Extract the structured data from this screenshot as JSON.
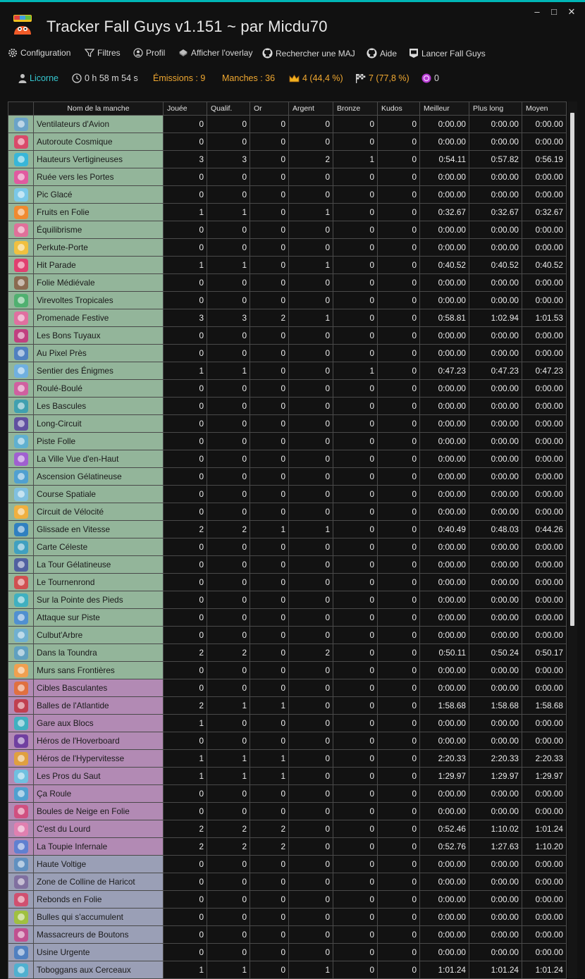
{
  "app": {
    "title": "Tracker Fall Guys v1.151 ~ par Micdu70",
    "minimize": "–",
    "maximize": "□",
    "close": "✕"
  },
  "menu": {
    "configuration": "Configuration",
    "filters": "Filtres",
    "profile": "Profil",
    "overlay": "Afficher l'overlay",
    "update": "Rechercher une MAJ",
    "help": "Aide",
    "launch": "Lancer Fall Guys"
  },
  "status": {
    "profile": "Licorne",
    "time": "0 h 58 m 54 s",
    "shows": "Émissions : 9",
    "rounds": "Manches : 36",
    "wins": "4 (44,4 %)",
    "finals": "7 (77,8 %)",
    "kudos": "0"
  },
  "colors": {
    "race": "#93b59a",
    "hunt": "#b28ab4",
    "final": "#9a9fb6",
    "accent_teal": "#00b6b6",
    "orange": "#f0a830"
  },
  "table": {
    "headers": [
      "Nom de la manche",
      "Jouée",
      "Qualif.",
      "Or",
      "Argent",
      "Bronze",
      "Kudos",
      "Meilleur",
      "Plus long",
      "Moyen"
    ],
    "rows": [
      {
        "cat": "race",
        "color": "#6aa3c8",
        "name": "Ventilateurs d'Avion",
        "v": [
          "0",
          "0",
          "0",
          "0",
          "0",
          "0",
          "0:00.00",
          "0:00.00",
          "0:00.00"
        ]
      },
      {
        "cat": "race",
        "color": "#d94a6a",
        "name": "Autoroute Cosmique",
        "v": [
          "0",
          "0",
          "0",
          "0",
          "0",
          "0",
          "0:00.00",
          "0:00.00",
          "0:00.00"
        ]
      },
      {
        "cat": "race",
        "color": "#38b6d8",
        "name": "Hauteurs Vertigineuses",
        "v": [
          "3",
          "3",
          "0",
          "2",
          "1",
          "0",
          "0:54.11",
          "0:57.82",
          "0:56.19"
        ]
      },
      {
        "cat": "race",
        "color": "#e05aa0",
        "name": "Ruée vers les Portes",
        "v": [
          "0",
          "0",
          "0",
          "0",
          "0",
          "0",
          "0:00.00",
          "0:00.00",
          "0:00.00"
        ]
      },
      {
        "cat": "race",
        "color": "#7ac8e8",
        "name": "Pic Glacé",
        "v": [
          "0",
          "0",
          "0",
          "0",
          "0",
          "0",
          "0:00.00",
          "0:00.00",
          "0:00.00"
        ]
      },
      {
        "cat": "race",
        "color": "#f08a30",
        "name": "Fruits en Folie",
        "v": [
          "1",
          "1",
          "0",
          "1",
          "0",
          "0",
          "0:32.67",
          "0:32.67",
          "0:32.67"
        ]
      },
      {
        "cat": "race",
        "color": "#e0709a",
        "name": "Équilibrisme",
        "v": [
          "0",
          "0",
          "0",
          "0",
          "0",
          "0",
          "0:00.00",
          "0:00.00",
          "0:00.00"
        ]
      },
      {
        "cat": "race",
        "color": "#f0c040",
        "name": "Perkute-Porte",
        "v": [
          "0",
          "0",
          "0",
          "0",
          "0",
          "0",
          "0:00.00",
          "0:00.00",
          "0:00.00"
        ]
      },
      {
        "cat": "race",
        "color": "#e04070",
        "name": "Hit Parade",
        "v": [
          "1",
          "1",
          "0",
          "1",
          "0",
          "0",
          "0:40.52",
          "0:40.52",
          "0:40.52"
        ]
      },
      {
        "cat": "race",
        "color": "#8a6a50",
        "name": "Folie Médiévale",
        "v": [
          "0",
          "0",
          "0",
          "0",
          "0",
          "0",
          "0:00.00",
          "0:00.00",
          "0:00.00"
        ]
      },
      {
        "cat": "race",
        "color": "#50b070",
        "name": "Virevoltes Tropicales",
        "v": [
          "0",
          "0",
          "0",
          "0",
          "0",
          "0",
          "0:00.00",
          "0:00.00",
          "0:00.00"
        ]
      },
      {
        "cat": "race",
        "color": "#e070a0",
        "name": "Promenade Festive",
        "v": [
          "3",
          "3",
          "2",
          "1",
          "0",
          "0",
          "0:58.81",
          "1:02.94",
          "1:01.53"
        ]
      },
      {
        "cat": "race",
        "color": "#c04080",
        "name": "Les Bons Tuyaux",
        "v": [
          "0",
          "0",
          "0",
          "0",
          "0",
          "0",
          "0:00.00",
          "0:00.00",
          "0:00.00"
        ]
      },
      {
        "cat": "race",
        "color": "#5080c0",
        "name": "Au Pixel Près",
        "v": [
          "0",
          "0",
          "0",
          "0",
          "0",
          "0",
          "0:00.00",
          "0:00.00",
          "0:00.00"
        ]
      },
      {
        "cat": "race",
        "color": "#70b0e0",
        "name": "Sentier des Énigmes",
        "v": [
          "1",
          "1",
          "0",
          "0",
          "1",
          "0",
          "0:47.23",
          "0:47.23",
          "0:47.23"
        ]
      },
      {
        "cat": "race",
        "color": "#d060a0",
        "name": "Roulé-Boulé",
        "v": [
          "0",
          "0",
          "0",
          "0",
          "0",
          "0",
          "0:00.00",
          "0:00.00",
          "0:00.00"
        ]
      },
      {
        "cat": "race",
        "color": "#40a0b0",
        "name": "Les Bascules",
        "v": [
          "0",
          "0",
          "0",
          "0",
          "0",
          "0",
          "0:00.00",
          "0:00.00",
          "0:00.00"
        ]
      },
      {
        "cat": "race",
        "color": "#6050a0",
        "name": "Long-Circuit",
        "v": [
          "0",
          "0",
          "0",
          "0",
          "0",
          "0",
          "0:00.00",
          "0:00.00",
          "0:00.00"
        ]
      },
      {
        "cat": "race",
        "color": "#60b0d0",
        "name": "Piste Folle",
        "v": [
          "0",
          "0",
          "0",
          "0",
          "0",
          "0",
          "0:00.00",
          "0:00.00",
          "0:00.00"
        ]
      },
      {
        "cat": "race",
        "color": "#a060d0",
        "name": "La Ville Vue d'en-Haut",
        "v": [
          "0",
          "0",
          "0",
          "0",
          "0",
          "0",
          "0:00.00",
          "0:00.00",
          "0:00.00"
        ]
      },
      {
        "cat": "race",
        "color": "#50a0d0",
        "name": "Ascension Gélatineuse",
        "v": [
          "0",
          "0",
          "0",
          "0",
          "0",
          "0",
          "0:00.00",
          "0:00.00",
          "0:00.00"
        ]
      },
      {
        "cat": "race",
        "color": "#80c0e0",
        "name": "Course Spatiale",
        "v": [
          "0",
          "0",
          "0",
          "0",
          "0",
          "0",
          "0:00.00",
          "0:00.00",
          "0:00.00"
        ]
      },
      {
        "cat": "race",
        "color": "#f0b040",
        "name": "Circuit de Vélocité",
        "v": [
          "0",
          "0",
          "0",
          "0",
          "0",
          "0",
          "0:00.00",
          "0:00.00",
          "0:00.00"
        ]
      },
      {
        "cat": "race",
        "color": "#3080c0",
        "name": "Glissade en Vitesse",
        "v": [
          "2",
          "2",
          "1",
          "1",
          "0",
          "0",
          "0:40.49",
          "0:48.03",
          "0:44.26"
        ]
      },
      {
        "cat": "race",
        "color": "#40a0c0",
        "name": "Carte Céleste",
        "v": [
          "0",
          "0",
          "0",
          "0",
          "0",
          "0",
          "0:00.00",
          "0:00.00",
          "0:00.00"
        ]
      },
      {
        "cat": "race",
        "color": "#5060a0",
        "name": "La Tour Gélatineuse",
        "v": [
          "0",
          "0",
          "0",
          "0",
          "0",
          "0",
          "0:00.00",
          "0:00.00",
          "0:00.00"
        ]
      },
      {
        "cat": "race",
        "color": "#d05050",
        "name": "Le Tournenrond",
        "v": [
          "0",
          "0",
          "0",
          "0",
          "0",
          "0",
          "0:00.00",
          "0:00.00",
          "0:00.00"
        ]
      },
      {
        "cat": "race",
        "color": "#40b0c0",
        "name": "Sur la Pointe des Pieds",
        "v": [
          "0",
          "0",
          "0",
          "0",
          "0",
          "0",
          "0:00.00",
          "0:00.00",
          "0:00.00"
        ]
      },
      {
        "cat": "race",
        "color": "#5090d0",
        "name": "Attaque sur Piste",
        "v": [
          "0",
          "0",
          "0",
          "0",
          "0",
          "0",
          "0:00.00",
          "0:00.00",
          "0:00.00"
        ]
      },
      {
        "cat": "race",
        "color": "#70b0d0",
        "name": "Culbut'Arbre",
        "v": [
          "0",
          "0",
          "0",
          "0",
          "0",
          "0",
          "0:00.00",
          "0:00.00",
          "0:00.00"
        ]
      },
      {
        "cat": "race",
        "color": "#60a0c0",
        "name": "Dans la Toundra",
        "v": [
          "2",
          "2",
          "0",
          "2",
          "0",
          "0",
          "0:50.11",
          "0:50.24",
          "0:50.17"
        ]
      },
      {
        "cat": "race",
        "color": "#f0a050",
        "name": "Murs sans Frontières",
        "v": [
          "0",
          "0",
          "0",
          "0",
          "0",
          "0",
          "0:00.00",
          "0:00.00",
          "0:00.00"
        ]
      },
      {
        "cat": "hunt",
        "color": "#e07040",
        "name": "Cibles Basculantes",
        "v": [
          "0",
          "0",
          "0",
          "0",
          "0",
          "0",
          "0:00.00",
          "0:00.00",
          "0:00.00"
        ]
      },
      {
        "cat": "hunt",
        "color": "#c04050",
        "name": "Balles de l'Atlantide",
        "v": [
          "2",
          "1",
          "1",
          "0",
          "0",
          "0",
          "1:58.68",
          "1:58.68",
          "1:58.68"
        ]
      },
      {
        "cat": "hunt",
        "color": "#40b0c0",
        "name": "Gare aux Blocs",
        "v": [
          "1",
          "0",
          "0",
          "0",
          "0",
          "0",
          "0:00.00",
          "0:00.00",
          "0:00.00"
        ]
      },
      {
        "cat": "hunt",
        "color": "#7040a0",
        "name": "Héros de l'Hoverboard",
        "v": [
          "0",
          "0",
          "0",
          "0",
          "0",
          "0",
          "0:00.00",
          "0:00.00",
          "0:00.00"
        ]
      },
      {
        "cat": "hunt",
        "color": "#e0a040",
        "name": "Héros de l'Hypervitesse",
        "v": [
          "1",
          "1",
          "1",
          "0",
          "0",
          "0",
          "2:20.33",
          "2:20.33",
          "2:20.33"
        ]
      },
      {
        "cat": "hunt",
        "color": "#70c0e0",
        "name": "Les Pros du Saut",
        "v": [
          "1",
          "1",
          "1",
          "0",
          "0",
          "0",
          "1:29.97",
          "1:29.97",
          "1:29.97"
        ]
      },
      {
        "cat": "hunt",
        "color": "#50a0d0",
        "name": "Ça Roule",
        "v": [
          "0",
          "0",
          "0",
          "0",
          "0",
          "0",
          "0:00.00",
          "0:00.00",
          "0:00.00"
        ]
      },
      {
        "cat": "hunt",
        "color": "#d05080",
        "name": "Boules de Neige en Folie",
        "v": [
          "0",
          "0",
          "0",
          "0",
          "0",
          "0",
          "0:00.00",
          "0:00.00",
          "0:00.00"
        ]
      },
      {
        "cat": "hunt",
        "color": "#e080b0",
        "name": "C'est du Lourd",
        "v": [
          "2",
          "2",
          "2",
          "0",
          "0",
          "0",
          "0:52.46",
          "1:10.02",
          "1:01.24"
        ]
      },
      {
        "cat": "hunt",
        "color": "#6080d0",
        "name": "La Toupie Infernale",
        "v": [
          "2",
          "2",
          "2",
          "0",
          "0",
          "0",
          "0:52.76",
          "1:27.63",
          "1:10.20"
        ]
      },
      {
        "cat": "final",
        "color": "#6090c0",
        "name": "Haute Voltige",
        "v": [
          "0",
          "0",
          "0",
          "0",
          "0",
          "0",
          "0:00.00",
          "0:00.00",
          "0:00.00"
        ]
      },
      {
        "cat": "final",
        "color": "#8070a0",
        "name": "Zone de Colline de Haricot",
        "v": [
          "0",
          "0",
          "0",
          "0",
          "0",
          "0",
          "0:00.00",
          "0:00.00",
          "0:00.00"
        ]
      },
      {
        "cat": "final",
        "color": "#d05070",
        "name": "Rebonds en Folie",
        "v": [
          "0",
          "0",
          "0",
          "0",
          "0",
          "0",
          "0:00.00",
          "0:00.00",
          "0:00.00"
        ]
      },
      {
        "cat": "final",
        "color": "#a0c040",
        "name": "Bulles qui s'accumulent",
        "v": [
          "0",
          "0",
          "0",
          "0",
          "0",
          "0",
          "0:00.00",
          "0:00.00",
          "0:00.00"
        ]
      },
      {
        "cat": "final",
        "color": "#c05090",
        "name": "Massacreurs de Boutons",
        "v": [
          "0",
          "0",
          "0",
          "0",
          "0",
          "0",
          "0:00.00",
          "0:00.00",
          "0:00.00"
        ]
      },
      {
        "cat": "final",
        "color": "#5080c0",
        "name": "Usine Urgente",
        "v": [
          "0",
          "0",
          "0",
          "0",
          "0",
          "0",
          "0:00.00",
          "0:00.00",
          "0:00.00"
        ]
      },
      {
        "cat": "final",
        "color": "#50b0d0",
        "name": "Toboggans aux Cerceaux",
        "v": [
          "1",
          "1",
          "0",
          "1",
          "0",
          "0",
          "1:01.24",
          "1:01.24",
          "1:01.24"
        ]
      }
    ]
  }
}
